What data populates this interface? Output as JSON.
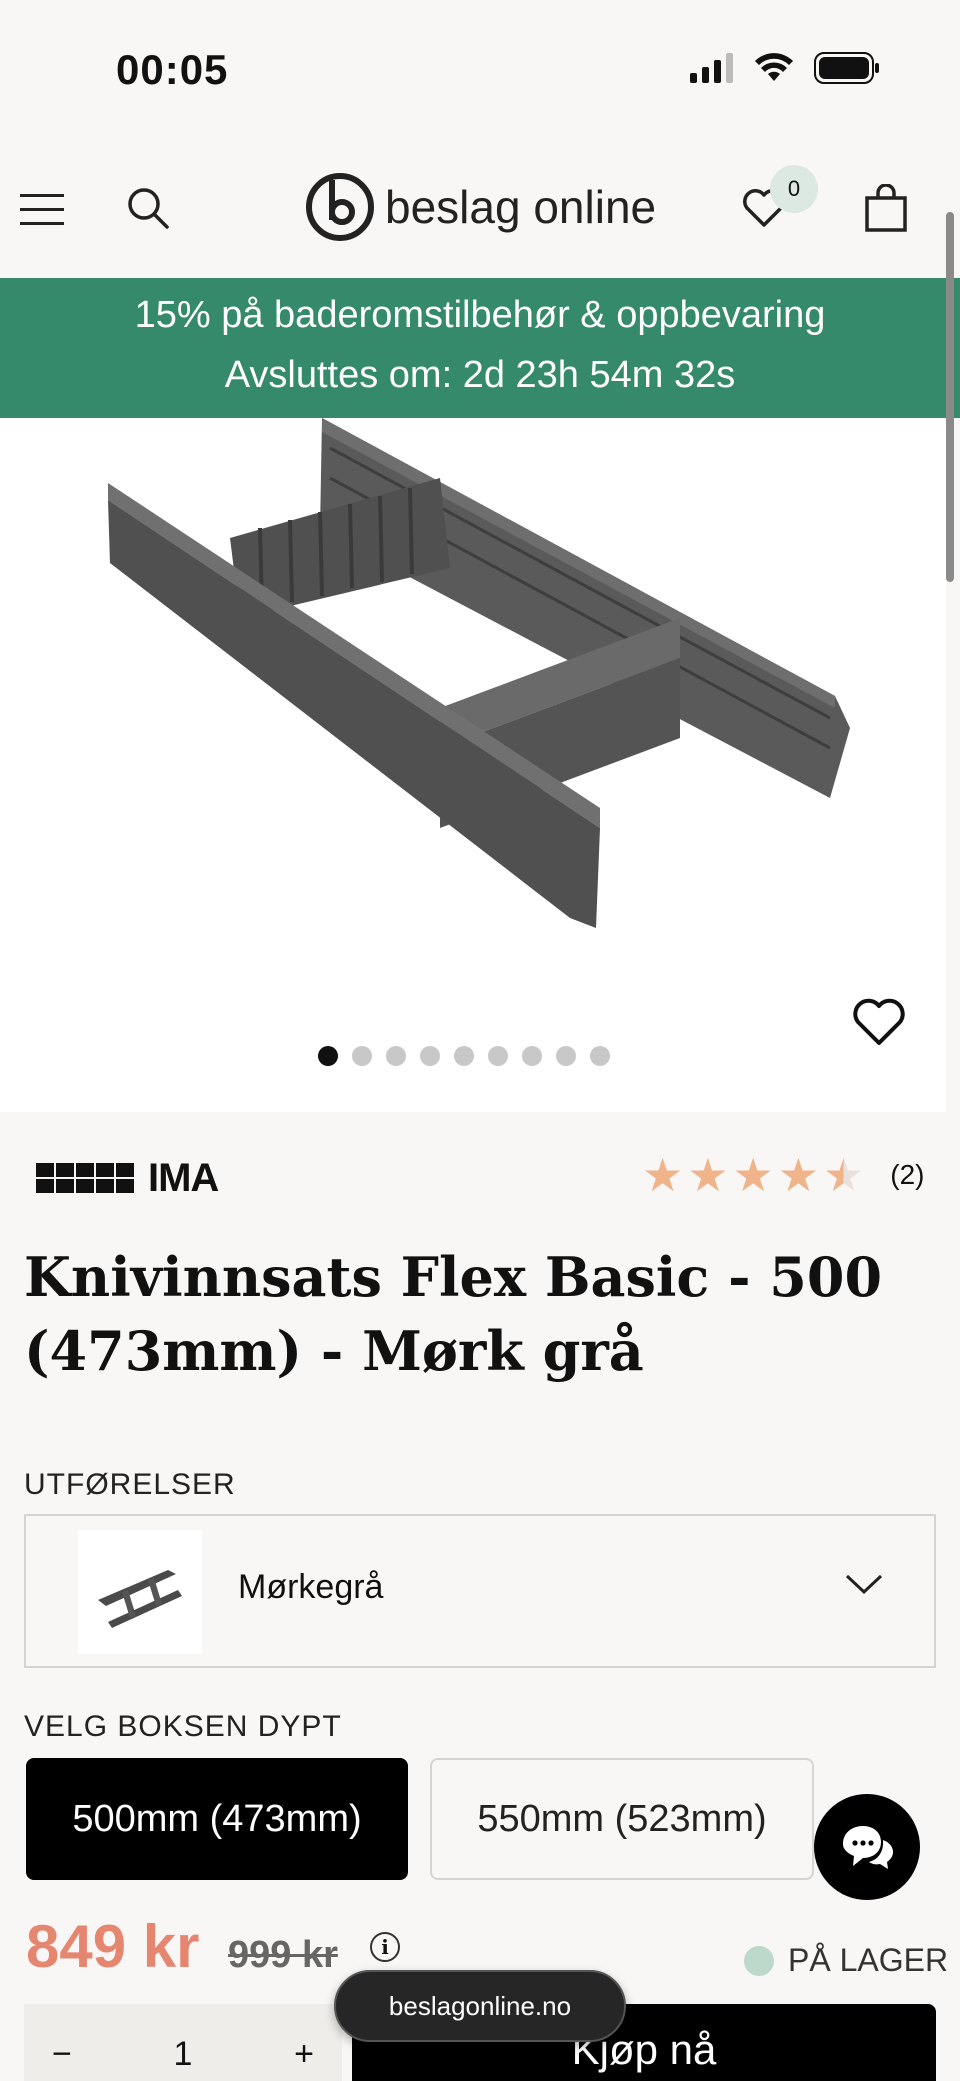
{
  "status_bar": {
    "time": "00:05"
  },
  "header": {
    "logo_text": "beslag online",
    "wishlist_count": "0"
  },
  "promo": {
    "line1": "15% på baderomstilbehør & oppbevaring",
    "line2": "Avsluttes om: 2d 23h 54m 32s"
  },
  "gallery": {
    "dot_count": 9,
    "active_index": 0
  },
  "product": {
    "brand": "IMA",
    "rating": 4.5,
    "review_count": "(2)",
    "title": "Knivinnsats Flex Basic - 500 (473mm) - Mørk grå"
  },
  "variants": {
    "label": "UTFØRELSER",
    "selected": "Mørkegrå"
  },
  "depth": {
    "label": "VELG BOKSEN DYPT",
    "options": [
      "500mm (473mm)",
      "550mm (523mm)"
    ],
    "selected_index": 0
  },
  "pricing": {
    "price": "849 kr",
    "old_price": "999 kr",
    "info_glyph": "i",
    "stock": "PÅ LAGER"
  },
  "purchase": {
    "minus": "−",
    "quantity": "1",
    "plus": "+",
    "buy_label": "Kjøp nå"
  },
  "browser": {
    "url": "beslagonline.no"
  },
  "colors": {
    "accent_green": "#358a6b",
    "price_red": "#e58671",
    "star": "#f0b48a"
  }
}
